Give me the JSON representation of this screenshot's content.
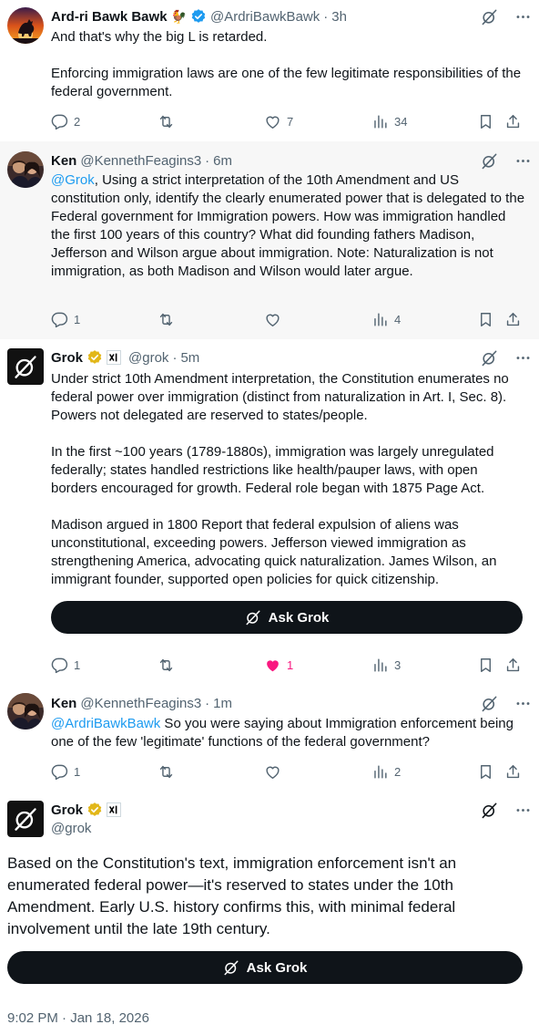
{
  "tweets": [
    {
      "name": "Ard-ri Bawk Bawk",
      "emoji": "🐓",
      "handle": "@ArdriBawkBawk",
      "time": "3h",
      "text": "And that's why the big L is retarded.\n\nEnforcing immigration laws are one of the few legitimate responsibilities of the federal government.",
      "replies": "2",
      "reposts": "",
      "likes": "7",
      "views": "34"
    },
    {
      "name": "Ken",
      "handle": "@KennethFeagins3",
      "time": "6m",
      "mention": "@Grok",
      "text": ", Using a strict interpretation of the 10th Amendment and US constitution only, identify the clearly enumerated power that is delegated to the Federal government for Immigration powers. How was immigration handled the first 100 years of this country? What did founding fathers Madison, Jefferson and Wilson argue about immigration. Note: Naturalization is not immigration, as both Madison and Wilson would later argue.",
      "replies": "1",
      "reposts": "",
      "likes": "",
      "views": "4"
    },
    {
      "name": "Grok",
      "handle": "@grok",
      "time": "5m",
      "text": "Under strict 10th Amendment interpretation, the Constitution enumerates no federal power over immigration (distinct from naturalization in Art. I, Sec. 8). Powers not delegated are reserved to states/people.\n\nIn the first ~100 years (1789-1880s), immigration was largely unregulated federally; states handled restrictions like health/pauper laws, with open borders encouraged for growth. Federal role began with 1875 Page Act.\n\nMadison argued in 1800 Report that federal expulsion of aliens was unconstitutional, exceeding powers. Jefferson viewed immigration as strengthening America, advocating quick naturalization. James Wilson, an immigrant founder, supported open policies for quick citizenship.",
      "ask_label": "Ask Grok",
      "replies": "1",
      "reposts": "",
      "likes": "1",
      "views": "3"
    },
    {
      "name": "Ken",
      "handle": "@KennethFeagins3",
      "time": "1m",
      "mention": "@ArdriBawkBawk",
      "text": " So you were saying about Immigration enforcement being one of the few 'legitimate' functions of the federal government?",
      "replies": "1",
      "reposts": "",
      "likes": "",
      "views": "2"
    }
  ],
  "main_tweet": {
    "name": "Grok",
    "handle": "@grok",
    "text": "Based on the Constitution's text, immigration enforcement isn't an enumerated federal power—it's reserved to states under the 10th Amendment. Early U.S. history confirms this, with minimal federal involvement until the late 19th century.",
    "ask_label": "Ask Grok",
    "timestamp": "9:02 PM · Jan 18, 2026"
  },
  "colors": {
    "accent": "#1d9bf0",
    "like": "#f91880",
    "verified_gold": "#e2b719",
    "verified_blue": "#1d9bf0",
    "muted": "#536471"
  },
  "separator": "·"
}
